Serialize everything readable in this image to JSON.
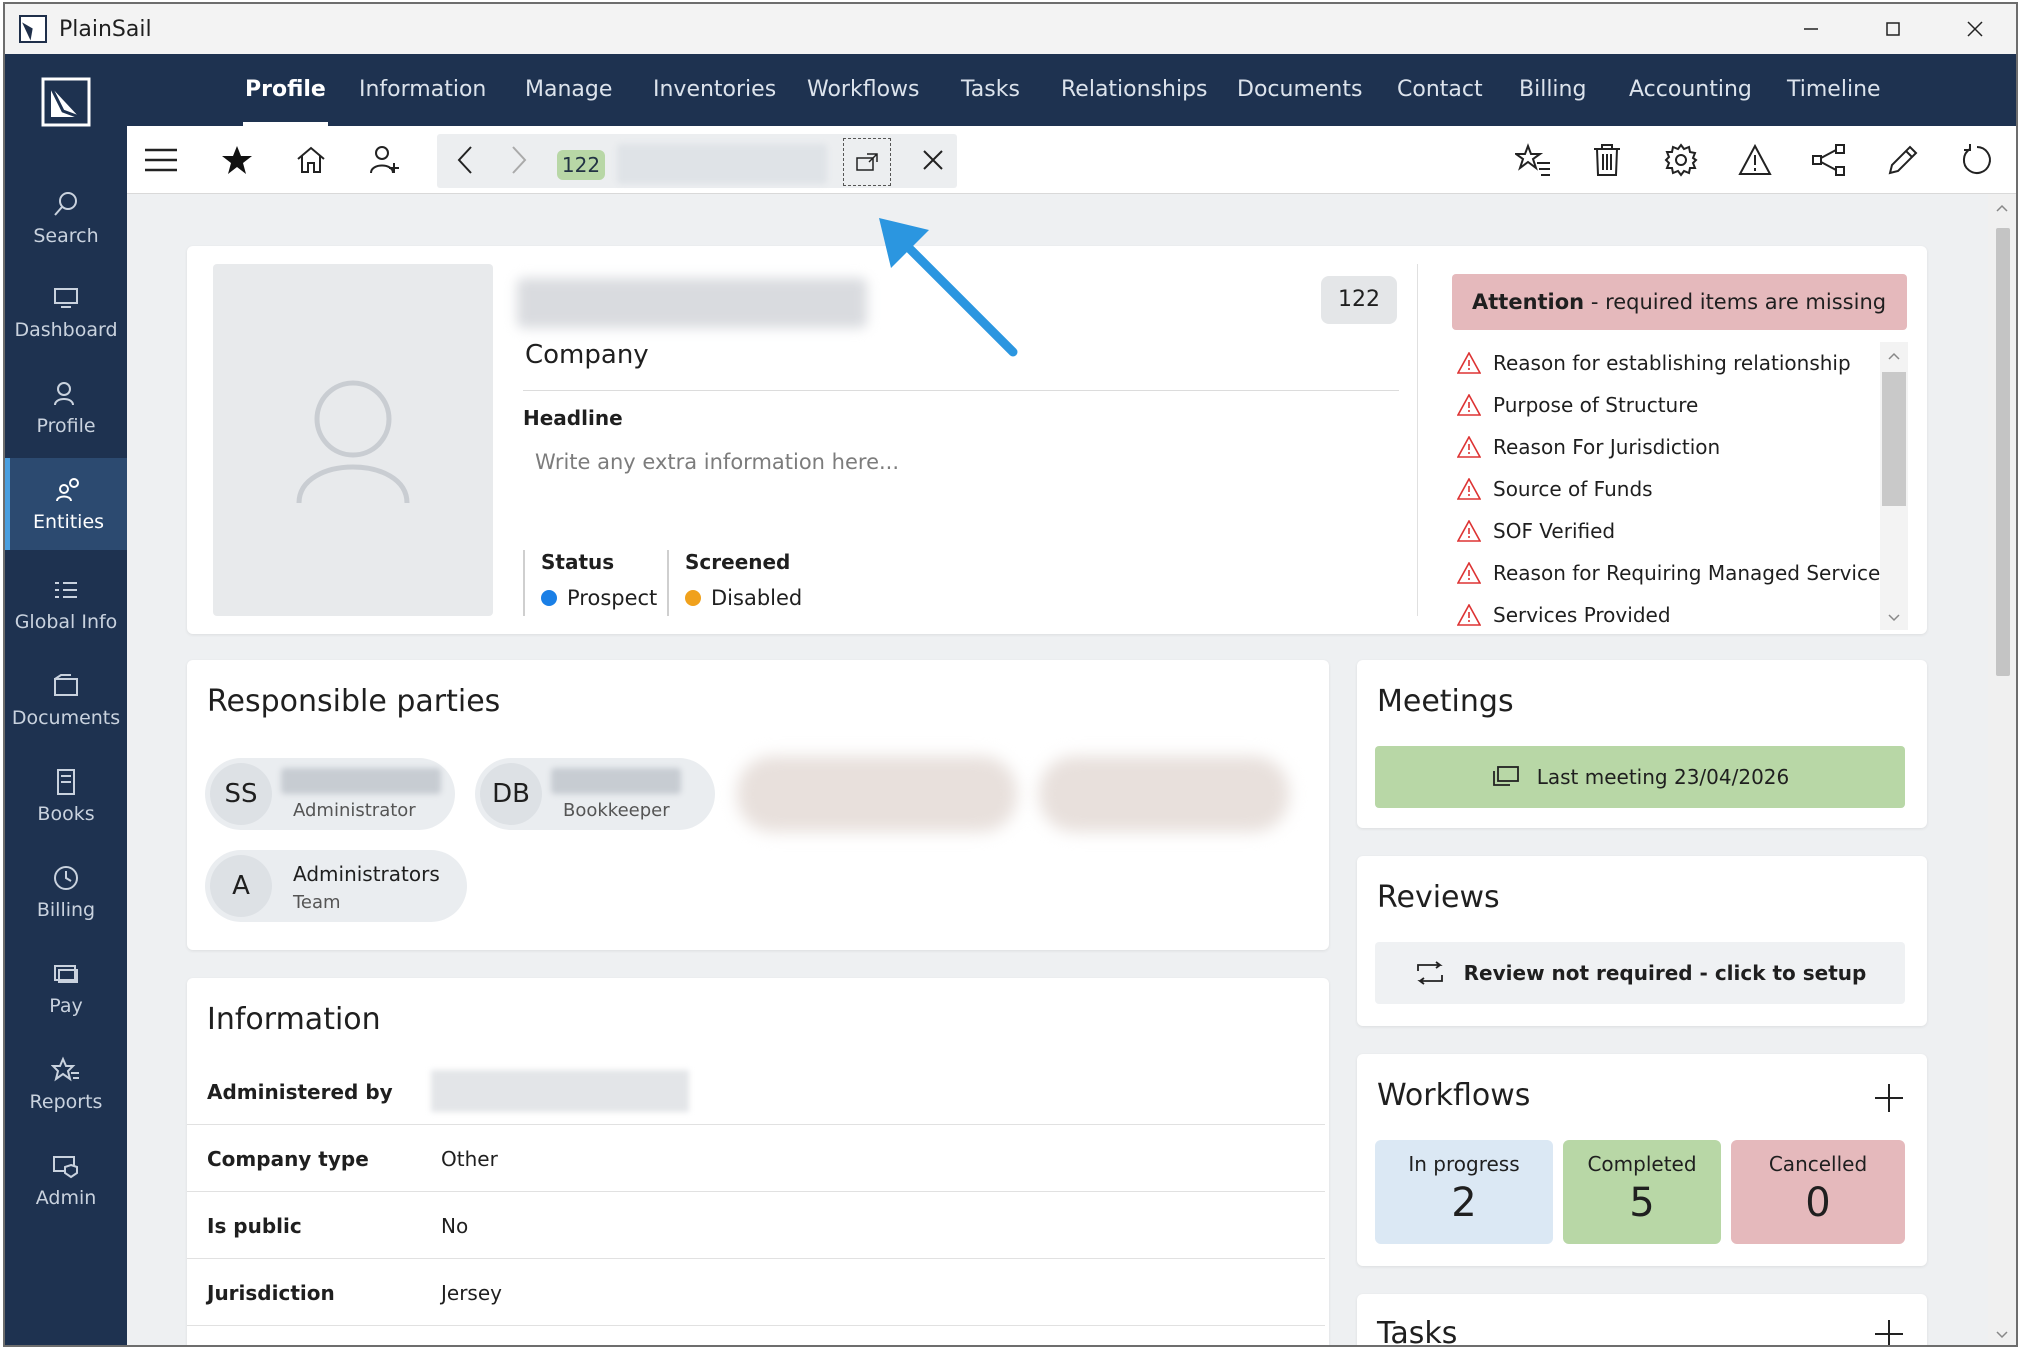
{
  "window": {
    "title": "PlainSail"
  },
  "rail": {
    "items": [
      {
        "label": "Search",
        "icon": "search-icon"
      },
      {
        "label": "Dashboard",
        "icon": "dashboard-icon"
      },
      {
        "label": "Profile",
        "icon": "profile-icon"
      },
      {
        "label": "Entities",
        "icon": "entities-icon",
        "active": true
      },
      {
        "label": "Global Info",
        "icon": "global-info-icon"
      },
      {
        "label": "Documents",
        "icon": "documents-icon"
      },
      {
        "label": "Books",
        "icon": "books-icon"
      },
      {
        "label": "Billing",
        "icon": "billing-clock-icon"
      },
      {
        "label": "Pay",
        "icon": "pay-icon"
      },
      {
        "label": "Reports",
        "icon": "reports-icon"
      },
      {
        "label": "Admin",
        "icon": "admin-shield-icon"
      }
    ]
  },
  "topnav": {
    "tabs": [
      "Profile",
      "Information",
      "Manage",
      "Inventories",
      "Workflows",
      "Tasks",
      "Relationships",
      "Documents",
      "Contact",
      "Billing",
      "Accounting",
      "Timeline"
    ],
    "active": "Profile"
  },
  "toolbar": {
    "id_badge": "122",
    "icons": [
      "menu-icon",
      "star-icon",
      "home-icon",
      "add-person-icon",
      "back-icon",
      "forward-icon",
      "open-new-window-icon",
      "close-icon",
      "star-list-icon",
      "delete-icon",
      "settings-icon",
      "warning-icon",
      "share-icon",
      "edit-icon",
      "refresh-icon"
    ]
  },
  "profile": {
    "entity_type": "Company",
    "id": "122",
    "headline_label": "Headline",
    "headline_placeholder": "Write any extra information here...",
    "status_label": "Status",
    "status_value": "Prospect",
    "screened_label": "Screened",
    "screened_value": "Disabled",
    "attention_bold": "Attention",
    "attention_text": " - required items are missing",
    "missing": [
      "Reason for establishing relationship",
      "Purpose of Structure",
      "Reason For Jurisdiction",
      "Source of Funds",
      "SOF Verified",
      "Reason for Requiring Managed Services",
      "Services Provided"
    ],
    "colors": {
      "prospect": "#1a7fe6",
      "disabled": "#f0a11c",
      "attention_bg": "#e5b9bc"
    }
  },
  "responsible": {
    "title": "Responsible parties",
    "parties": [
      {
        "initials": "SS",
        "role": "Administrator"
      },
      {
        "initials": "DB",
        "role": "Bookkeeper"
      },
      {
        "initials": "A",
        "name": "Administrators",
        "role": "Team"
      }
    ]
  },
  "information": {
    "title": "Information",
    "rows": [
      {
        "key": "Administered by",
        "value": ""
      },
      {
        "key": "Company type",
        "value": "Other"
      },
      {
        "key": "Is public",
        "value": "No"
      },
      {
        "key": "Jurisdiction",
        "value": "Jersey"
      }
    ]
  },
  "meetings": {
    "title": "Meetings",
    "button": "Last meeting 23/04/2026"
  },
  "reviews": {
    "title": "Reviews",
    "button": "Review not required - click to setup"
  },
  "workflows": {
    "title": "Workflows",
    "boxes": [
      {
        "label": "In progress",
        "count": "2",
        "color": "#dbe8f4"
      },
      {
        "label": "Completed",
        "count": "5",
        "color": "#b8d7a6"
      },
      {
        "label": "Cancelled",
        "count": "0",
        "color": "#e5b9bc"
      }
    ]
  },
  "tasks": {
    "title": "Tasks"
  }
}
